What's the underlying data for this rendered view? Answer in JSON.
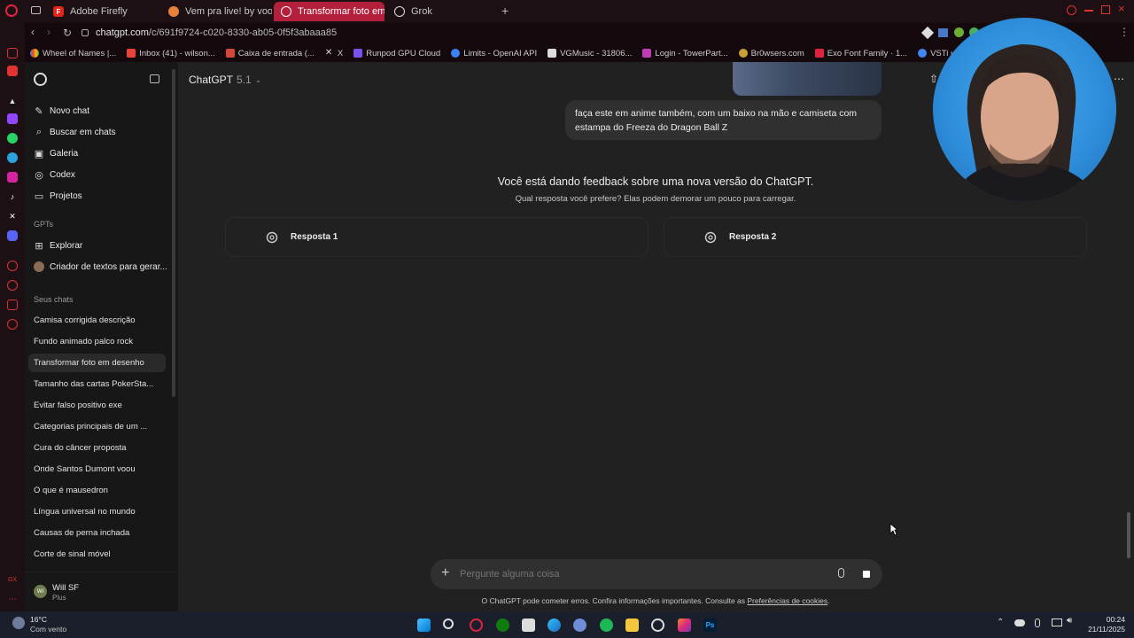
{
  "browser": {
    "tabs": [
      {
        "label": "Adobe Firefly"
      },
      {
        "label": "Vem pra live! by voodu..."
      },
      {
        "label": "Transformar foto em des..."
      },
      {
        "label": "Grok"
      }
    ],
    "url_host": "chatgpt.com",
    "url_path": "/c/691f9724-c020-8330-ab05-0f5f3abaaa85",
    "bookmarks": [
      "Wheel of Names |...",
      "Inbox (41) - wilson...",
      "Caixa de entrada (...",
      "X",
      "Runpod GPU Cloud",
      "Limits - OpenAI API",
      "VGMusic - 31806...",
      "Login - TowerPart...",
      "Br0wsers.com",
      "Exo Font Family · 1...",
      "VSTi инструмент..."
    ]
  },
  "sidebar": {
    "nav": [
      {
        "label": "Novo chat",
        "icon": "edit-icon"
      },
      {
        "label": "Buscar em chats",
        "icon": "search-icon"
      },
      {
        "label": "Galeria",
        "icon": "image-icon"
      },
      {
        "label": "Codex",
        "icon": "code-icon"
      },
      {
        "label": "Projetos",
        "icon": "folder-icon"
      }
    ],
    "gpts_label": "GPTs",
    "gpts": [
      {
        "label": "Explorar",
        "icon": "grid-icon"
      },
      {
        "label": "Criador de textos para gerar...",
        "icon": "avatar-icon"
      }
    ],
    "chats_label": "Seus chats",
    "chats": [
      "Camisa corrigida descrição",
      "Fundo animado palco rock",
      "Transformar foto em desenho",
      "Tamanho das cartas PokerSta...",
      "Evitar falso positivo exe",
      "Categorias principais de um ...",
      "Cura do câncer proposta",
      "Onde Santos Dumont voou",
      "O que é mausedron",
      "Língua universal no mundo",
      "Causas de perna inchada",
      "Corte de sinal móvel"
    ],
    "user_name": "Will SF",
    "user_plan": "Plus",
    "user_initials": "WI"
  },
  "main": {
    "model_name": "ChatGPT",
    "model_version": "5.1",
    "user_message": "faça este em anime também, com um baixo na mão e camiseta com estampa do Freeza do Dragon  Ball Z",
    "feedback_title": "Você está dando feedback sobre uma nova versão do ChatGPT.",
    "feedback_subtitle": "Qual resposta você prefere? Elas podem demorar um pouco para carregar.",
    "responses": [
      "Resposta 1",
      "Resposta 2"
    ],
    "composer_placeholder": "Pergunte alguma coisa",
    "footer_text": "O ChatGPT pode cometer erros. Confira informações importantes. Consulte as ",
    "footer_link": "Preferências de cookies",
    "footer_end": "."
  },
  "taskbar": {
    "weather_temp": "16°C",
    "weather_desc": "Com vento",
    "time": "00:24",
    "date": "21/11/2025"
  }
}
